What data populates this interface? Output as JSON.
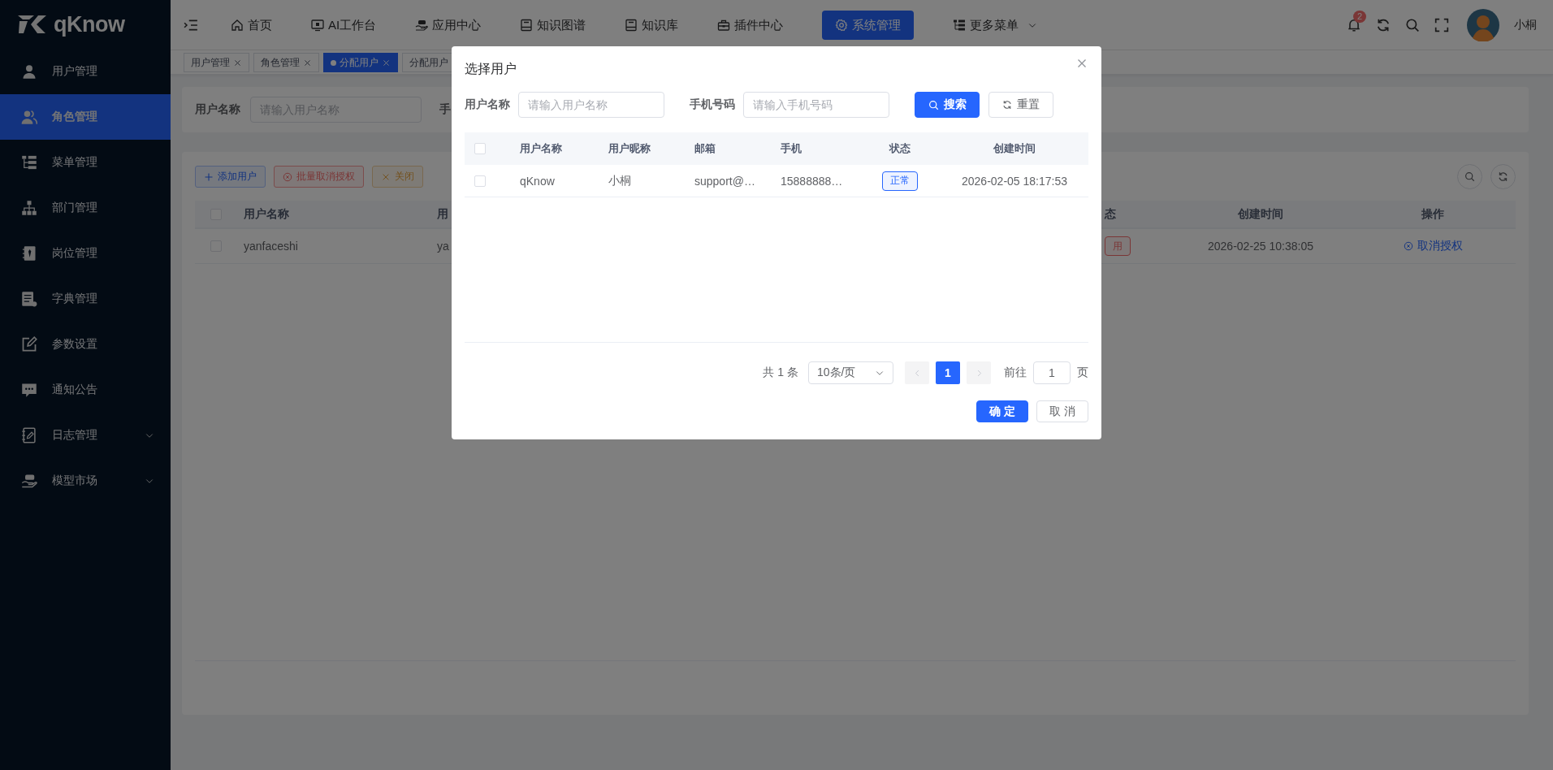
{
  "sidebar": {
    "logo": "qKnow",
    "items": [
      {
        "label": "用户管理",
        "selected": false,
        "has_children": false
      },
      {
        "label": "角色管理",
        "selected": true,
        "has_children": false
      },
      {
        "label": "菜单管理",
        "selected": false,
        "has_children": false
      },
      {
        "label": "部门管理",
        "selected": false,
        "has_children": false
      },
      {
        "label": "岗位管理",
        "selected": false,
        "has_children": false
      },
      {
        "label": "字典管理",
        "selected": false,
        "has_children": false
      },
      {
        "label": "参数设置",
        "selected": false,
        "has_children": false
      },
      {
        "label": "通知公告",
        "selected": false,
        "has_children": false
      },
      {
        "label": "日志管理",
        "selected": false,
        "has_children": true
      },
      {
        "label": "模型市场",
        "selected": false,
        "has_children": true
      }
    ]
  },
  "top_nav": {
    "items": [
      {
        "label": "首页",
        "selected": false,
        "has_dropdown": false
      },
      {
        "label": "AI工作台",
        "selected": false,
        "has_dropdown": false
      },
      {
        "label": "应用中心",
        "selected": false,
        "has_dropdown": false
      },
      {
        "label": "知识图谱",
        "selected": false,
        "has_dropdown": false
      },
      {
        "label": "知识库",
        "selected": false,
        "has_dropdown": false
      },
      {
        "label": "插件中心",
        "selected": false,
        "has_dropdown": false
      },
      {
        "label": "系统管理",
        "selected": true,
        "has_dropdown": false
      },
      {
        "label": "更多菜单",
        "selected": false,
        "has_dropdown": true
      }
    ],
    "notification_count": "2",
    "user_name": "小桐"
  },
  "tags": [
    {
      "label": "用户管理",
      "selected": false,
      "closable": true
    },
    {
      "label": "角色管理",
      "selected": false,
      "closable": true
    },
    {
      "label": "分配用户",
      "selected": true,
      "closable": true
    },
    {
      "label": "分配用户",
      "selected": false
    }
  ],
  "search_form": {
    "fields": [
      {
        "label": "用户名称",
        "placeholder": "请输入用户名称"
      },
      {
        "label": "手"
      }
    ]
  },
  "toolbar": {
    "buttons": [
      {
        "label": "添加用户",
        "kind": "primary"
      },
      {
        "label": "批量取消授权",
        "kind": "danger"
      },
      {
        "label": "关闭",
        "kind": "warning"
      }
    ]
  },
  "table": {
    "all_checked": false,
    "columns": [
      "用户名称",
      "用",
      "态",
      "创建时间",
      "操作"
    ],
    "rows": [
      {
        "checked": false,
        "user_name": "yanfaceshi",
        "column_2": "ya",
        "status": "用",
        "created": "2026-02-25 10:38:05",
        "action": "取消授权"
      }
    ]
  },
  "dialog": {
    "title": "选择用户",
    "fields": [
      {
        "label": "用户名称",
        "placeholder": "请输入用户名称"
      },
      {
        "label": "手机号码",
        "placeholder": "请输入手机号码"
      }
    ],
    "search_button": "搜索",
    "reset_button": "重置",
    "table": {
      "all_checked": false,
      "columns": [
        "用户名称",
        "用户昵称",
        "邮箱",
        "手机",
        "状态",
        "创建时间"
      ],
      "rows": [
        {
          "checked": false,
          "user_name": "qKnow",
          "nick_name": "小桐",
          "email": "support@…",
          "phone": "15888888…",
          "status": "正常",
          "color": "#2666fe",
          "created": "2026-02-05 18:17:53"
        }
      ]
    },
    "pagination": {
      "total": "共 1 条",
      "page_size": "10条/页",
      "pages": [
        {
          "label": "1",
          "selected": true
        }
      ],
      "goto_label": "前往",
      "goto_value": "1",
      "goto_suffix": "页"
    },
    "confirm": "确 定",
    "cancel": "取 消"
  }
}
